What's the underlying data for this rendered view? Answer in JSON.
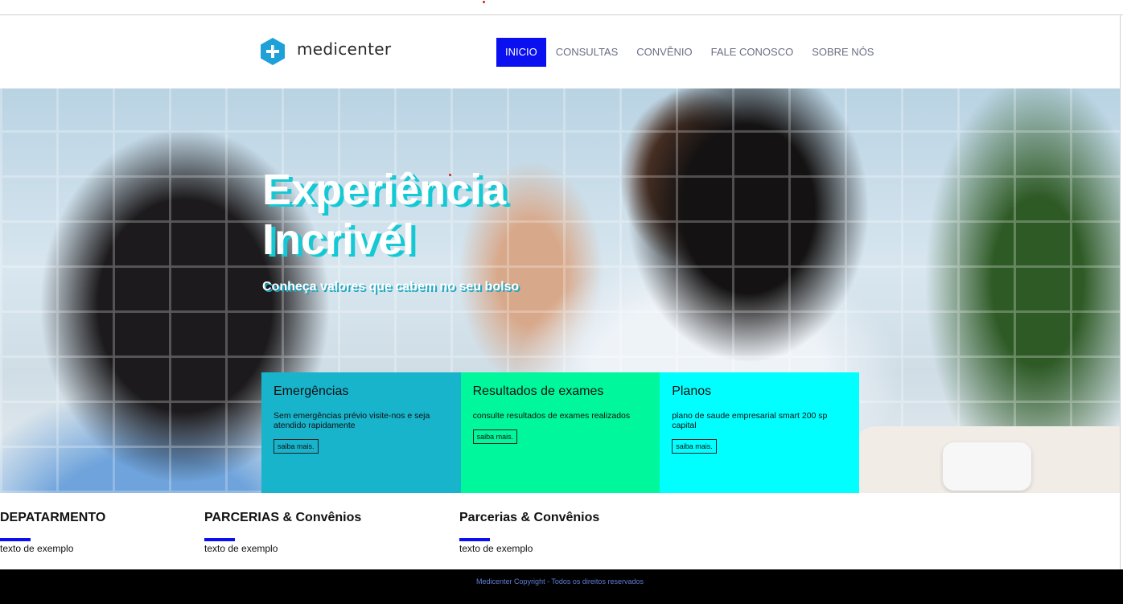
{
  "brand": {
    "name": "medicenter",
    "logo_color": "#1ea0d8"
  },
  "nav": {
    "items": [
      {
        "label": "INICIO",
        "active": true
      },
      {
        "label": "CONSULTAS",
        "active": false
      },
      {
        "label": "CONVÊNIO",
        "active": false
      },
      {
        "label": "FALE CONOSCO",
        "active": false
      },
      {
        "label": "SOBRE NÓS",
        "active": false
      }
    ],
    "active_color": "#0a10f0"
  },
  "hero": {
    "title": "Experiência Incrivél",
    "subtitle": "Conheça valores que cabem no seu bolso"
  },
  "cards": [
    {
      "title": "Emergências",
      "text": "Sem emergências prévio visite-nos e seja atendido rapidamente",
      "button": "saiba mais.",
      "color": "#17b4cc"
    },
    {
      "title": "Resultados de exames",
      "text": "consulte resultados de exames realizados",
      "button": "saiba mais.",
      "color": "#00f79b"
    },
    {
      "title": "Planos",
      "text": "plano de saude empresarial smart 200 sp capital",
      "button": "saiba mais.",
      "color": "#00ffff"
    }
  ],
  "sections": [
    {
      "title": "DEPATARMENTO",
      "text": "texto de exemplo"
    },
    {
      "title": "PARCERIAS & Convênios",
      "text": "texto de exemplo"
    },
    {
      "title": "Parcerias & Convênios",
      "text": "texto de exemplo"
    }
  ],
  "footer": {
    "text": "Medicenter Copyright - Todos os direitos reservados"
  }
}
